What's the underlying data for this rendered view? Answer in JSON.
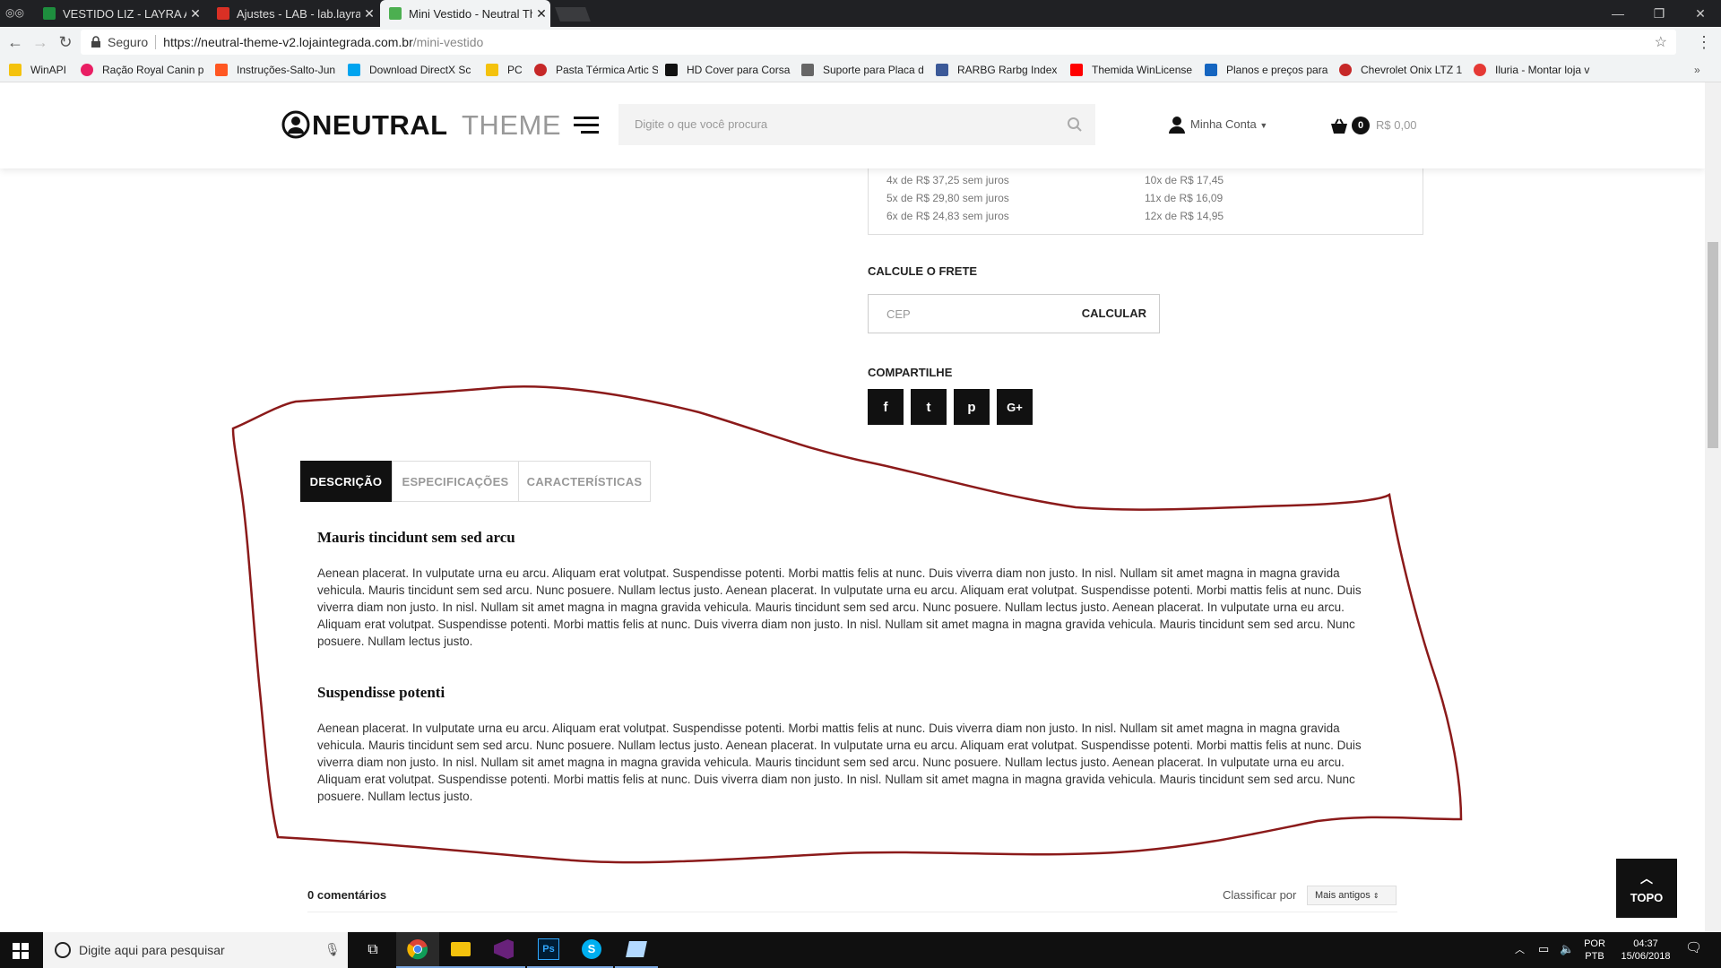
{
  "browser": {
    "tabs": [
      {
        "title": "VESTIDO LIZ - LAYRA ABE",
        "active": false,
        "color": "#1e8e3e"
      },
      {
        "title": "Ajustes - LAB - lab.layraa",
        "active": false,
        "color": "#d93025"
      },
      {
        "title": "Mini Vestido - Neutral Th",
        "active": true,
        "color": "#4caf50"
      }
    ],
    "secure_label": "Seguro",
    "url_domain": "https://neutral-theme-v2.lojaintegrada.com.br",
    "url_path": "/mini-vestido",
    "bookmarks": [
      {
        "label": "WinAPI",
        "color": "#f4c20d"
      },
      {
        "label": "Ração Royal Canin p",
        "color": "#e91e63"
      },
      {
        "label": "Instruções-Salto-Jun",
        "color": "#ff5722"
      },
      {
        "label": "Download DirectX Sc",
        "color": "#00a4ef"
      },
      {
        "label": "PC",
        "color": "#f4c20d"
      },
      {
        "label": "Pasta Térmica Artic S",
        "color": "#c62828"
      },
      {
        "label": "HD Cover para Corsa",
        "color": "#111111"
      },
      {
        "label": "Suporte para Placa d",
        "color": "#666666"
      },
      {
        "label": "RARBG Rarbg Index",
        "color": "#3b5998"
      },
      {
        "label": "Themida WinLicense",
        "color": "#ff0000"
      },
      {
        "label": "Planos e preços para",
        "color": "#1565c0"
      },
      {
        "label": "Chevrolet Onix LTZ 1",
        "color": "#c62828"
      },
      {
        "label": "Iluria - Montar loja v",
        "color": "#e53935"
      }
    ]
  },
  "site": {
    "logo_bold": "NEUTRAL",
    "logo_light": "THEME",
    "search_placeholder": "Digite o que você procura",
    "account_label": "Minha Conta",
    "cart_count": "0",
    "cart_total": "R$ 0,00"
  },
  "installments": {
    "left": [
      "4x de R$ 37,25 sem juros",
      "5x de R$ 29,80 sem juros",
      "6x de R$ 24,83 sem juros"
    ],
    "right": [
      "10x de R$ 17,45",
      "11x de R$ 16,09",
      "12x de R$ 14,95"
    ]
  },
  "shipping": {
    "title": "CALCULE O FRETE",
    "cep_placeholder": "CEP",
    "button": "CALCULAR"
  },
  "share": {
    "title": "COMPARTILHE",
    "buttons": [
      "f",
      "t",
      "p",
      "G+"
    ]
  },
  "product_tabs": [
    "DESCRIÇÃO",
    "ESPECIFICAÇÕES",
    "CARACTERÍSTICAS"
  ],
  "description": {
    "heading1": "Mauris tincidunt sem sed arcu",
    "para1": "Aenean placerat. In vulputate urna eu arcu. Aliquam erat volutpat. Suspendisse potenti. Morbi mattis felis at nunc. Duis viverra diam non justo. In nisl. Nullam sit amet magna in magna gravida vehicula. Mauris tincidunt sem sed arcu. Nunc posuere. Nullam lectus justo. Aenean placerat. In vulputate urna eu arcu. Aliquam erat volutpat. Suspendisse potenti. Morbi mattis felis at nunc. Duis viverra diam non justo. In nisl. Nullam sit amet magna in magna gravida vehicula. Mauris tincidunt sem sed arcu. Nunc posuere. Nullam lectus justo. Aenean placerat. In vulputate urna eu arcu. Aliquam erat volutpat. Suspendisse potenti. Morbi mattis felis at nunc. Duis viverra diam non justo. In nisl. Nullam sit amet magna in magna gravida vehicula. Mauris tincidunt sem sed arcu. Nunc posuere. Nullam lectus justo.",
    "heading2": "Suspendisse potenti",
    "para2": "Aenean placerat. In vulputate urna eu arcu. Aliquam erat volutpat. Suspendisse potenti. Morbi mattis felis at nunc. Duis viverra diam non justo. In nisl. Nullam sit amet magna in magna gravida vehicula. Mauris tincidunt sem sed arcu. Nunc posuere. Nullam lectus justo. Aenean placerat. In vulputate urna eu arcu. Aliquam erat volutpat. Suspendisse potenti. Morbi mattis felis at nunc. Duis viverra diam non justo. In nisl. Nullam sit amet magna in magna gravida vehicula. Mauris tincidunt sem sed arcu. Nunc posuere. Nullam lectus justo. Aenean placerat. In vulputate urna eu arcu. Aliquam erat volutpat. Suspendisse potenti. Morbi mattis felis at nunc. Duis viverra diam non justo. In nisl. Nullam sit amet magna in magna gravida vehicula. Mauris tincidunt sem sed arcu. Nunc posuere. Nullam lectus justo."
  },
  "comments": {
    "count_label": "0 comentários",
    "sort_label": "Classificar por",
    "sort_value": "Mais antigos"
  },
  "topo_label": "TOPO",
  "taskbar": {
    "search_placeholder": "Digite aqui para pesquisar",
    "lang_top": "POR",
    "lang_bottom": "PTB",
    "time": "04:37",
    "date": "15/06/2018"
  },
  "annotation_color": "#8b1a1a"
}
